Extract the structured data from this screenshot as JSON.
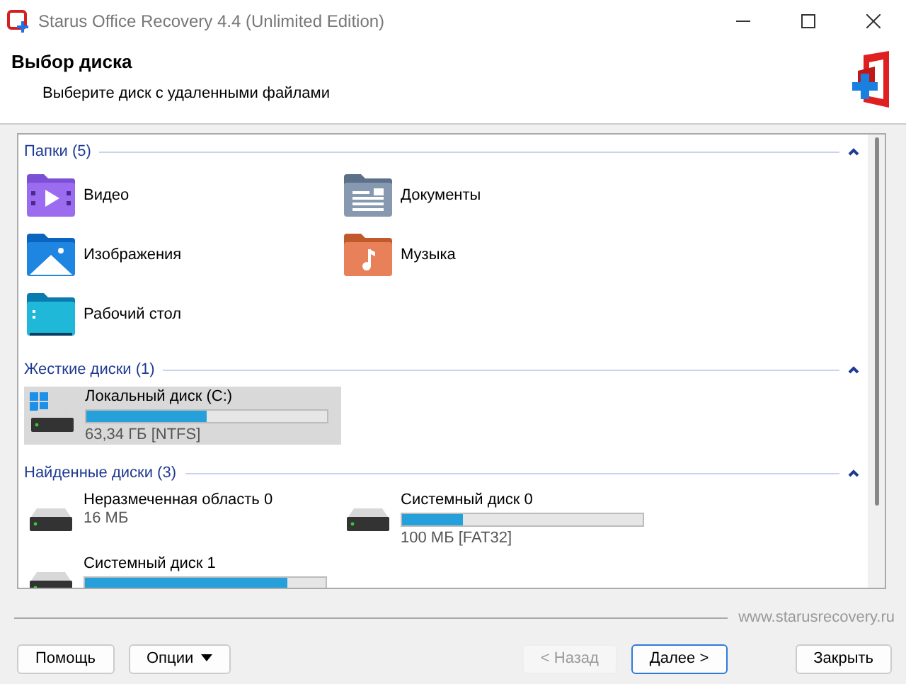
{
  "window": {
    "title": "Starus Office Recovery 4.4 (Unlimited Edition)"
  },
  "header": {
    "title": "Выбор диска",
    "subtitle": "Выберите диск с удаленными файлами"
  },
  "sections": [
    {
      "title": "Папки (5)",
      "expanded": true,
      "kind": "folders",
      "items": [
        {
          "label": "Видео",
          "kind": "video"
        },
        {
          "label": "Документы",
          "kind": "documents"
        },
        {
          "label": "Изображения",
          "kind": "images"
        },
        {
          "label": "Музыка",
          "kind": "music"
        },
        {
          "label": "Рабочий стол",
          "kind": "desktop"
        }
      ]
    },
    {
      "title": "Жесткие диски (1)",
      "expanded": true,
      "kind": "disks",
      "items": [
        {
          "name": "Локальный диск (C:)",
          "level": 0.5,
          "info": "63,34 ГБ [NTFS]",
          "selected": true,
          "os_logo": true
        }
      ]
    },
    {
      "title": "Найденные диски (3)",
      "expanded": true,
      "kind": "disks",
      "items": [
        {
          "name": "Неразмеченная область 0",
          "info": "16 МБ",
          "selected": false,
          "os_logo": false
        },
        {
          "name": "Системный диск 0",
          "level": 0.25,
          "info": "100 МБ [FAT32]",
          "selected": false,
          "os_logo": false
        },
        {
          "name": "Системный диск 1",
          "level": 0.84,
          "selected": false,
          "os_logo": false
        }
      ]
    }
  ],
  "footer": {
    "url": "www.starusrecovery.ru"
  },
  "buttons": [
    {
      "label": "Помощь",
      "disabled": false,
      "default": false,
      "dropdown": false
    },
    {
      "label": "Опции",
      "disabled": false,
      "default": false,
      "dropdown": true
    },
    {
      "label": "< Назад",
      "disabled": true,
      "default": false,
      "dropdown": false
    },
    {
      "label": "Далее >",
      "disabled": false,
      "default": true,
      "dropdown": false
    },
    {
      "label": "Закрыть",
      "disabled": false,
      "default": false,
      "dropdown": false
    }
  ]
}
